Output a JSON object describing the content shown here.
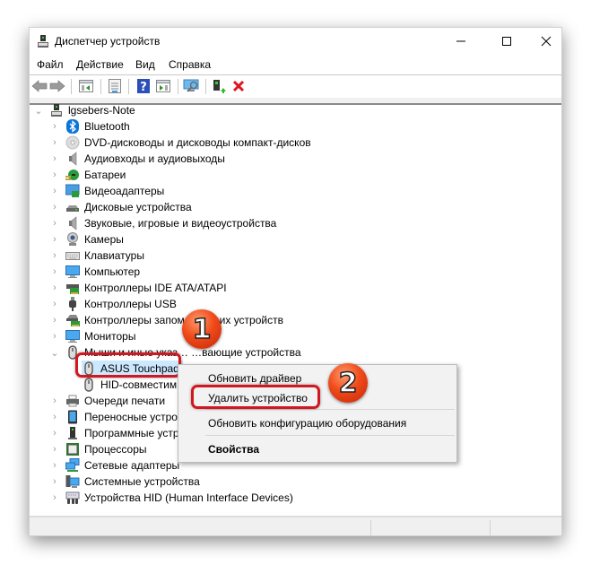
{
  "window": {
    "title": "Диспетчер устройств",
    "controls": {
      "minimize": "—",
      "maximize": "☐",
      "close": "✕"
    }
  },
  "menubar": {
    "items": [
      "Файл",
      "Действие",
      "Вид",
      "Справка"
    ]
  },
  "toolbar": {
    "buttons": [
      {
        "name": "back",
        "icon": "arrow-left-icon"
      },
      {
        "name": "forward",
        "icon": "arrow-right-icon"
      },
      {
        "name": "show-hide-console-tree",
        "icon": "console-tree-icon"
      },
      {
        "name": "properties",
        "icon": "properties-icon"
      },
      {
        "name": "help",
        "icon": "help-icon",
        "glyph": "?"
      },
      {
        "name": "action-pane",
        "icon": "action-pane-icon"
      },
      {
        "name": "scan-hardware",
        "icon": "scan-hardware-icon"
      },
      {
        "name": "update-driver",
        "icon": "update-driver-icon"
      },
      {
        "name": "uninstall-device",
        "icon": "uninstall-icon",
        "glyph": "✖"
      }
    ]
  },
  "tree": {
    "root": "lgsebers-Note",
    "categories": [
      {
        "label": "Bluetooth",
        "icon": "bluetooth-icon"
      },
      {
        "label": "DVD-дисководы и дисководы компакт-дисков",
        "icon": "dvd-icon"
      },
      {
        "label": "Аудиовходы и аудиовыходы",
        "icon": "speaker-icon"
      },
      {
        "label": "Батареи",
        "icon": "battery-icon"
      },
      {
        "label": "Видеоадаптеры",
        "icon": "display-adapter-icon"
      },
      {
        "label": "Дисковые устройства",
        "icon": "disk-drive-icon"
      },
      {
        "label": "Звуковые, игровые и видеоустройства",
        "icon": "speaker-icon"
      },
      {
        "label": "Камеры",
        "icon": "camera-icon"
      },
      {
        "label": "Клавиатуры",
        "icon": "keyboard-icon"
      },
      {
        "label": "Компьютер",
        "icon": "computer-icon"
      },
      {
        "label": "Контроллеры IDE ATA/ATAPI",
        "icon": "ide-controller-icon"
      },
      {
        "label": "Контроллеры USB",
        "icon": "usb-icon"
      },
      {
        "label": "Контроллеры запоминающих устройств",
        "icon": "storage-controller-icon"
      },
      {
        "label": "Мониторы",
        "icon": "monitor-icon"
      },
      {
        "label": "Мыши и иные указывающие устройства",
        "icon": "mouse-icon",
        "expanded": true,
        "children": [
          "ASUS Touchpad",
          "HID-совместимая мышь"
        ]
      },
      {
        "label": "Очереди печати",
        "icon": "printer-icon"
      },
      {
        "label": "Переносные устройства",
        "icon": "portable-device-icon"
      },
      {
        "label": "Программные устройства",
        "icon": "software-device-icon"
      },
      {
        "label": "Процессоры",
        "icon": "processor-icon"
      },
      {
        "label": "Сетевые адаптеры",
        "icon": "network-adapter-icon"
      },
      {
        "label": "Системные устройства",
        "icon": "system-device-icon"
      },
      {
        "label": "Устройства HID (Human Interface Devices)",
        "icon": "hid-icon"
      }
    ],
    "visible_labels": {
      "mice": "Мыши и иные указ… …вающие устройства",
      "hid_mouse": "HID-совместим",
      "portable": "Переносные устро",
      "software": "Программные устр"
    },
    "selected": "ASUS Touchpad"
  },
  "context_menu": {
    "items": [
      {
        "label": "Обновить драйвер",
        "bold": false
      },
      {
        "label": "Удалить устройство",
        "bold": false,
        "highlighted": true
      },
      {
        "label": "Обновить конфигурацию оборудования",
        "bold": false
      },
      {
        "label": "Свойства",
        "bold": true
      }
    ]
  },
  "annotations": {
    "step1": "1",
    "step2": "2",
    "callout_color": "#d1171f"
  },
  "colors": {
    "selection": "#cce8ff",
    "badge": "#f04a1a",
    "uninstall_red": "#e0141e",
    "help_blue": "#2a4fb8"
  }
}
